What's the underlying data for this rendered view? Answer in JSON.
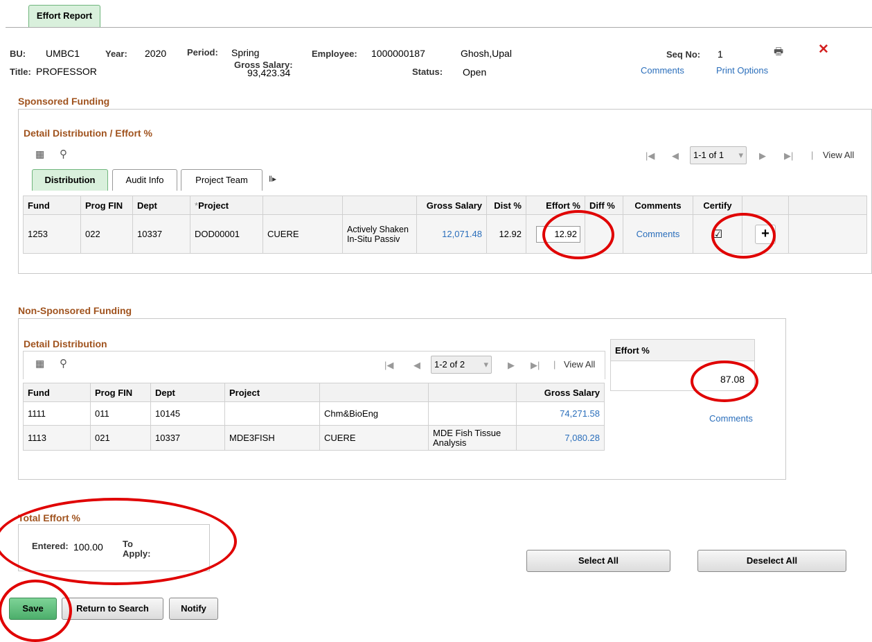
{
  "page_tab": "Effort Report",
  "header": {
    "bu_label": "BU:",
    "bu": "UMBC1",
    "year_label": "Year:",
    "year": "2020",
    "period_label": "Period:",
    "period": "Spring",
    "employee_label": "Employee:",
    "employee_id": "1000000187",
    "employee_name": "Ghosh,Upal",
    "seq_label": "Seq No:",
    "seq": "1",
    "title_label": "Title:",
    "title": "PROFESSOR",
    "gross_label": "Gross Salary:",
    "gross": "93,423.34",
    "status_label": "Status:",
    "status": "Open",
    "comments_link": "Comments",
    "print_link": "Print Options"
  },
  "sponsored": {
    "title": "Sponsored Funding",
    "subtitle": "Detail Distribution / Effort %",
    "pager": "1-1 of 1",
    "view_all": "View All",
    "tabs": [
      "Distribution",
      "Audit Info",
      "Project Team"
    ],
    "columns": [
      "Fund",
      "Prog FIN",
      "Dept",
      "Project",
      "",
      "",
      "Gross Salary",
      "Dist %",
      "Effort %",
      "Diff %",
      "Comments",
      "Certify",
      "",
      ""
    ],
    "required_mark": "*",
    "row": {
      "fund": "1253",
      "prog": "022",
      "dept": "10337",
      "project": "DOD00001",
      "desc1": "CUERE",
      "desc2": "Actively Shaken In-Situ Passiv",
      "gross": "12,071.48",
      "dist": "12.92",
      "effort": "12.92",
      "comments": "Comments",
      "certify": "☑",
      "add": "+"
    }
  },
  "nonsponsored": {
    "title": "Non-Sponsored Funding",
    "subtitle": "Detail Distribution",
    "pager": "1-2 of 2",
    "view_all": "View All",
    "columns": [
      "Fund",
      "Prog FIN",
      "Dept",
      "Project",
      "",
      "",
      "Gross Salary"
    ],
    "rows": [
      {
        "fund": "1111",
        "prog": "011",
        "dept": "10145",
        "project": "",
        "desc1": "Chm&BioEng",
        "desc2": "",
        "gross": "74,271.58"
      },
      {
        "fund": "1113",
        "prog": "021",
        "dept": "10337",
        "project": "MDE3FISH",
        "desc1": "CUERE",
        "desc2": "MDE Fish Tissue Analysis",
        "gross": "7,080.28"
      }
    ],
    "effort_label": "Effort %",
    "effort_value": "87.08",
    "comments_link": "Comments"
  },
  "total": {
    "title": "Total Effort %",
    "entered_label": "Entered:",
    "entered": "100.00",
    "to_apply_label": "To Apply:"
  },
  "buttons": {
    "select_all": "Select All",
    "deselect_all": "Deselect All",
    "save": "Save",
    "return_search": "Return to Search",
    "notify": "Notify"
  },
  "colors": {
    "accent_green": "#d9f0dc",
    "section_title": "#a0531e",
    "link": "#2a6ebb",
    "annotation_red": "#e00000"
  }
}
